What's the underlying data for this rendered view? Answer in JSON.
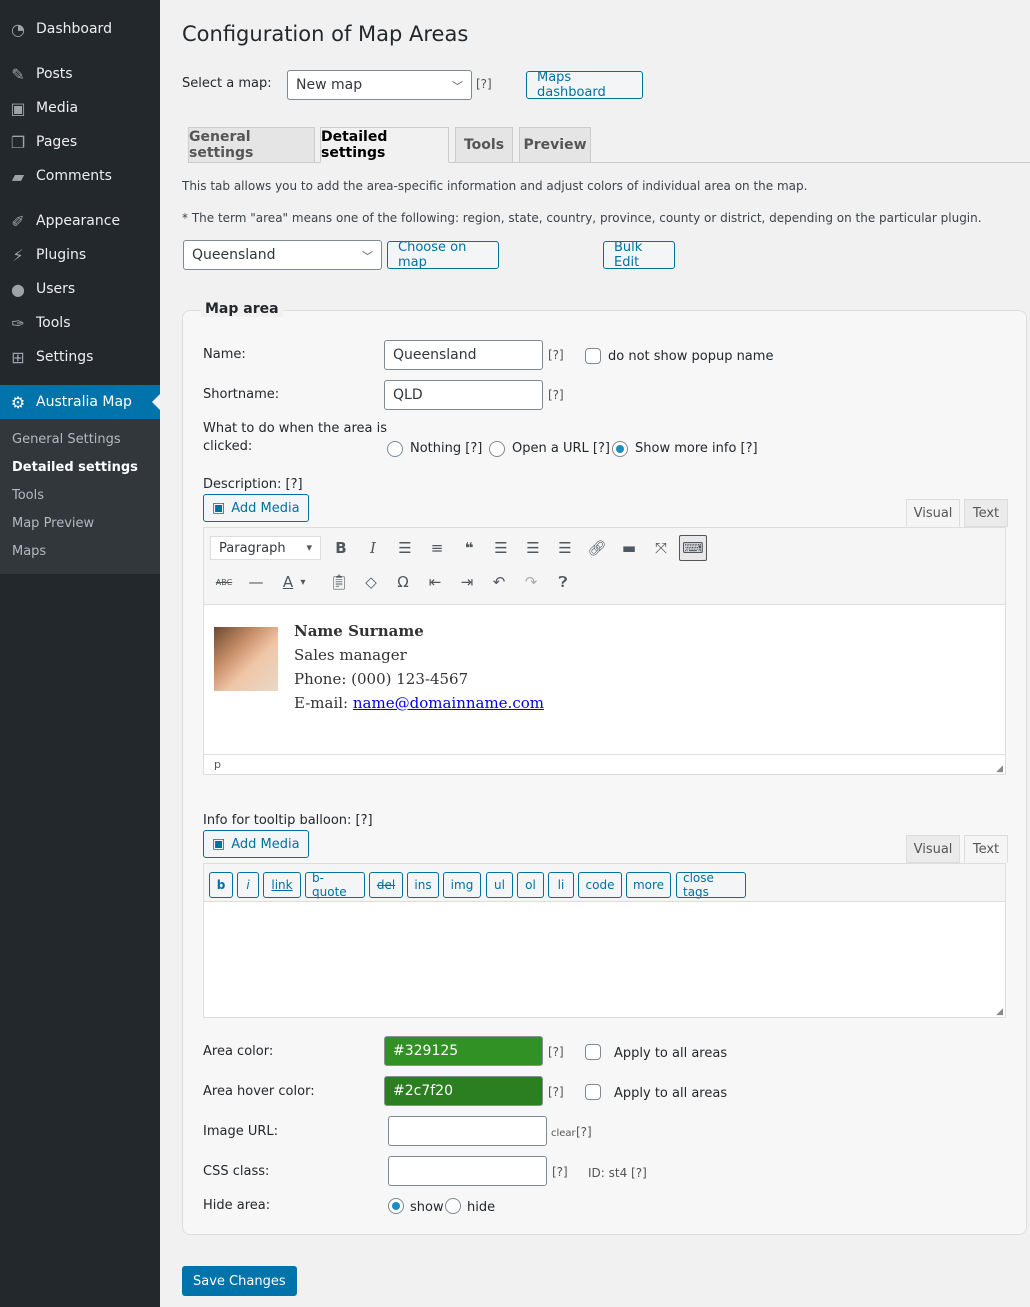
{
  "sidebar": {
    "items": [
      {
        "label": "Dashboard",
        "icon": "dashboard-icon"
      },
      {
        "label": "Posts",
        "icon": "pin-icon"
      },
      {
        "label": "Media",
        "icon": "media-icon"
      },
      {
        "label": "Pages",
        "icon": "pages-icon"
      },
      {
        "label": "Comments",
        "icon": "comment-icon"
      },
      {
        "label": "Appearance",
        "icon": "brush-icon"
      },
      {
        "label": "Plugins",
        "icon": "plug-icon"
      },
      {
        "label": "Users",
        "icon": "user-icon"
      },
      {
        "label": "Tools",
        "icon": "wrench-icon"
      },
      {
        "label": "Settings",
        "icon": "settings-icon"
      },
      {
        "label": "Australia Map",
        "icon": "gear-icon",
        "active": true
      }
    ],
    "submenu": [
      "General Settings",
      "Detailed settings",
      "Tools",
      "Map Preview",
      "Maps"
    ],
    "submenu_current": "Detailed settings"
  },
  "header": {
    "title": "Configuration of Map Areas",
    "select_map_label": "Select a map:",
    "select_map_value": "New map",
    "help": "[?]",
    "maps_dashboard_label": "Maps dashboard"
  },
  "tabs": [
    {
      "label": "General settings"
    },
    {
      "label": "Detailed settings",
      "active": true
    },
    {
      "label": "Tools"
    },
    {
      "label": "Preview"
    }
  ],
  "intro": {
    "line1": "This tab allows you to add the area-specific information and adjust colors of individual area on the map.",
    "line2": "* The term \"area\" means one of the following: region, state, country, province, county or district, depending on the particular plugin.",
    "area_select_value": "Queensland",
    "choose_on_map_label": "Choose on map",
    "bulk_edit_label": "Bulk Edit"
  },
  "map_area": {
    "legend": "Map area",
    "name_label": "Name:",
    "name_value": "Queensland",
    "no_popup_label": "do not show popup name",
    "shortname_label": "Shortname:",
    "shortname_value": "QLD",
    "click_label_1": "What to do when the area is",
    "click_label_2": "clicked:",
    "click_options": [
      "Nothing [?]",
      "Open a URL [?]",
      "Show more info [?]"
    ],
    "click_selected": "Show more info [?]",
    "description_label": "Description: [?]",
    "add_media_label": "Add Media",
    "visual_tab": "Visual",
    "text_tab": "Text",
    "format_select": "Paragraph",
    "status_path": "p",
    "card": {
      "name": "Name Surname",
      "title": "Sales manager",
      "phone": "Phone: (000) 123-4567",
      "email_prefix": "E-mail: ",
      "email": "name@domainname.com"
    },
    "tooltip_label": "Info for tooltip balloon: [?]",
    "quicktags": [
      "b",
      "i",
      "link",
      "b-quote",
      "del",
      "ins",
      "img",
      "ul",
      "ol",
      "li",
      "code",
      "more",
      "close tags"
    ],
    "tooltip_value": "",
    "area_color_label": "Area color:",
    "area_color_value": "#329125",
    "area_hover_color_label": "Area hover color:",
    "area_hover_color_value": "#2c7f20",
    "apply_all_label": "Apply to all areas",
    "image_url_label": "Image URL:",
    "image_url_value": "",
    "clear_label": "clear",
    "css_class_label": "CSS class:",
    "css_class_value": "",
    "id_label": "ID: st4 [?]",
    "hide_area_label": "Hide area:",
    "hide_options": [
      "show",
      "hide"
    ],
    "hide_selected": "show"
  },
  "save_label": "Save Changes"
}
